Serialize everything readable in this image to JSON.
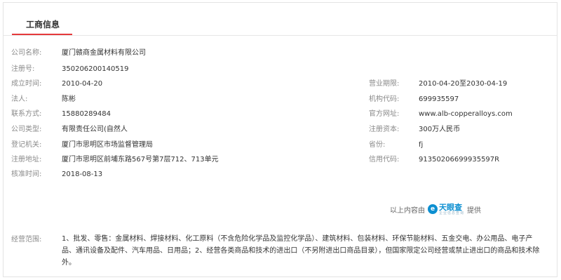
{
  "tab": {
    "label": "工商信息"
  },
  "left_fields": [
    {
      "label": "公司名称:",
      "value": "厦门赣商金属材料有限公司"
    },
    {
      "label": "注册号:",
      "value": "350206200140519"
    },
    {
      "label": "成立时间:",
      "value": "2010-04-20"
    },
    {
      "label": "法人:",
      "value": "陈彬"
    },
    {
      "label": "联系方式:",
      "value": "15880289484"
    },
    {
      "label": "公司类型:",
      "value": "有限责任公司(自然人"
    },
    {
      "label": "登记机关:",
      "value": "厦门市思明区市场监督管理局"
    },
    {
      "label": "注册地址:",
      "value": "厦门市思明区前埔东路567号第7层712、713单元"
    },
    {
      "label": "核准时间:",
      "value": "2018-08-13"
    }
  ],
  "right_fields": [
    {
      "label": "营业期限:",
      "value": "2010-04-20至2030-04-19"
    },
    {
      "label": "机构代码:",
      "value": "699935597"
    },
    {
      "label": "官方网址:",
      "value": "www.alb-copperalloys.com"
    },
    {
      "label": "注册资本:",
      "value": "300万人民币"
    },
    {
      "label": "省份:",
      "value": "fj"
    },
    {
      "label": "信用代码:",
      "value": "91350206699935597R"
    }
  ],
  "provider": {
    "prefix": "以上内容由",
    "logo_mark": "e",
    "logo_name": "天眼查",
    "logo_sub": "企业信息查询",
    "suffix": "提供",
    "brand_color": "#0c8fd1"
  },
  "scope": {
    "label": "经营范围:",
    "text": "1、批发、零售：金属材料、焊接材料、化工原料（不含危险化学品及监控化学品）、建筑材料、包装材料、环保节能材料、五金交电、办公用品、电子产品、通讯设备及配件、汽车用品、日用品；2、经营各类商品和技术的进出口（不另附进出口商品目录），但国家限定公司经营或禁止进出口的商品和技术除外。"
  },
  "colors": {
    "accent": "#e5393b",
    "label": "#8a8a8a",
    "text": "#333333"
  }
}
